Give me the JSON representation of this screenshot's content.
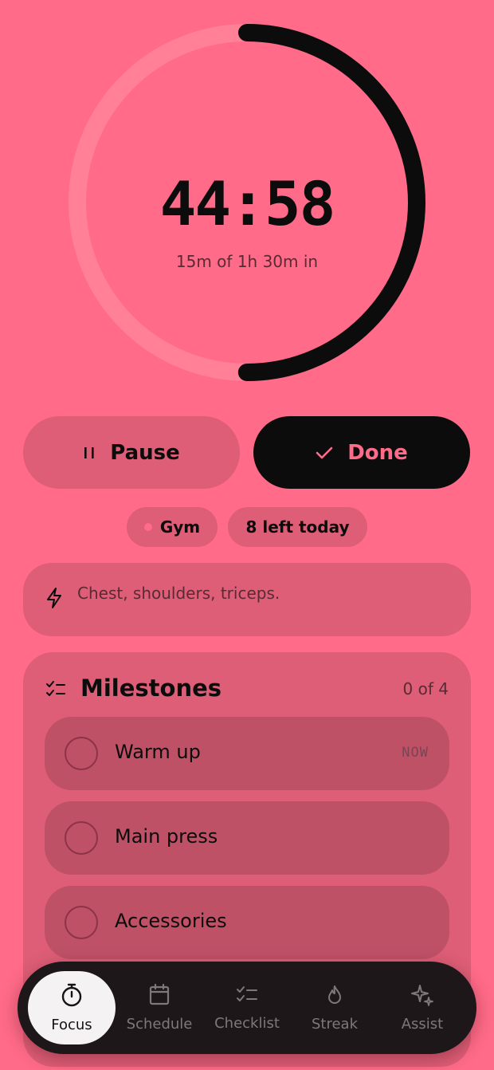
{
  "timer": {
    "time": "44:58",
    "subtitle": "15m of 1h 30m in",
    "progress": 0.5
  },
  "actions": {
    "pause_label": "Pause",
    "pause_icon": "pause-icon",
    "done_label": "Done",
    "done_icon": "check-icon"
  },
  "chips": {
    "category": "Gym",
    "remaining": "8 left today"
  },
  "note": {
    "icon": "lightning-icon",
    "text": "Chest, shoulders, triceps."
  },
  "milestones": {
    "title": "Milestones",
    "count": "0 of 4",
    "items": [
      {
        "label": "Warm up",
        "tag": "NOW",
        "done": false
      },
      {
        "label": "Main press",
        "tag": "",
        "done": false
      },
      {
        "label": "Accessories",
        "tag": "",
        "done": false
      }
    ]
  },
  "nav": {
    "items": [
      {
        "label": "Focus",
        "icon": "stopwatch-icon",
        "active": true
      },
      {
        "label": "Schedule",
        "icon": "calendar-icon",
        "active": false
      },
      {
        "label": "Checklist",
        "icon": "checklist-icon",
        "active": false
      },
      {
        "label": "Streak",
        "icon": "flame-icon",
        "active": false
      },
      {
        "label": "Assist",
        "icon": "sparkle-icon",
        "active": false
      }
    ]
  },
  "colors": {
    "background": "#ff6b88",
    "card": "#dd5e76",
    "item": "#bf5167",
    "ink": "#0c0c0c",
    "nav": "#1d1719"
  }
}
